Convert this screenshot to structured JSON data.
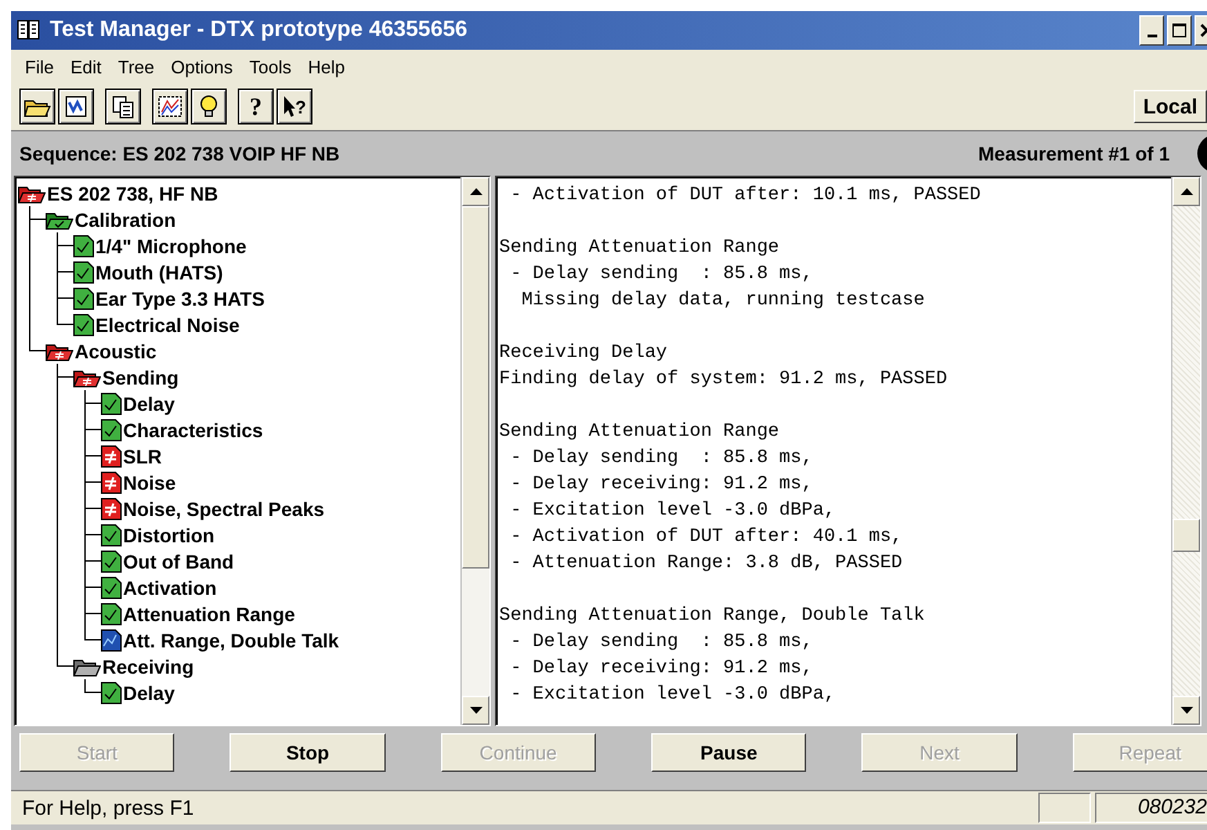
{
  "window": {
    "title": "Test Manager - DTX prototype 46355656"
  },
  "menu": [
    "File",
    "Edit",
    "Tree",
    "Options",
    "Tools",
    "Help"
  ],
  "toolbar": {
    "help_glyph": "?",
    "context_help_glyph": "?",
    "mode_button": "Local"
  },
  "sequence_bar": {
    "sequence": "Sequence: ES 202 738 VOIP HF NB",
    "measurement": "Measurement #1 of 1"
  },
  "tree": [
    {
      "label": "ES 202 738, HF NB",
      "kind": "folder",
      "passed": false,
      "failed": true,
      "children": [
        {
          "label": "Calibration",
          "kind": "folder",
          "passed": true,
          "failed": false,
          "children": [
            {
              "label": "1/4\" Microphone",
              "kind": "test",
              "passed": true,
              "failed": false
            },
            {
              "label": "Mouth (HATS)",
              "kind": "test",
              "passed": true,
              "failed": false
            },
            {
              "label": "Ear Type 3.3 HATS",
              "kind": "test",
              "passed": true,
              "failed": false
            },
            {
              "label": "Electrical Noise",
              "kind": "test",
              "passed": true,
              "failed": false
            }
          ]
        },
        {
          "label": "Acoustic",
          "kind": "folder",
          "passed": false,
          "failed": true,
          "children": [
            {
              "label": "Sending",
              "kind": "folder",
              "passed": false,
              "failed": true,
              "children": [
                {
                  "label": "Delay",
                  "kind": "test",
                  "passed": true,
                  "failed": false
                },
                {
                  "label": "Characteristics",
                  "kind": "test",
                  "passed": true,
                  "failed": false
                },
                {
                  "label": "SLR",
                  "kind": "test",
                  "passed": false,
                  "failed": true
                },
                {
                  "label": "Noise",
                  "kind": "test",
                  "passed": false,
                  "failed": true
                },
                {
                  "label": "Noise, Spectral Peaks",
                  "kind": "test",
                  "passed": false,
                  "failed": true
                },
                {
                  "label": "Distortion",
                  "kind": "test",
                  "passed": true,
                  "failed": false
                },
                {
                  "label": "Out of Band",
                  "kind": "test",
                  "passed": true,
                  "failed": false
                },
                {
                  "label": "Activation",
                  "kind": "test",
                  "passed": true,
                  "failed": false
                },
                {
                  "label": "Attenuation Range",
                  "kind": "test",
                  "passed": true,
                  "failed": false
                },
                {
                  "label": "Att. Range, Double Talk",
                  "kind": "test",
                  "passed": false,
                  "failed": false
                }
              ]
            },
            {
              "label": "Receiving",
              "kind": "folder",
              "passed": false,
              "failed": false,
              "children": [
                {
                  "label": "Delay",
                  "kind": "test",
                  "passed": true,
                  "failed": false
                }
              ]
            }
          ]
        }
      ]
    }
  ],
  "log": [
    [
      " - Activation of DUT after: 10.1 ms, PASSED"
    ],
    [
      "Sending Attenuation Range",
      " - Delay sending  : 85.8 ms,",
      "  Missing delay data, running testcase"
    ],
    [
      "Receiving Delay",
      "Finding delay of system: 91.2 ms, PASSED"
    ],
    [
      "Sending Attenuation Range",
      " - Delay sending  : 85.8 ms,",
      " - Delay receiving: 91.2 ms,",
      " - Excitation level -3.0 dBPa,",
      " - Activation of DUT after: 40.1 ms,",
      " - Attenuation Range: 3.8 dB, PASSED"
    ],
    [
      "Sending Attenuation Range, Double Talk",
      " - Delay sending  : 85.8 ms,",
      " - Delay receiving: 91.2 ms,",
      " - Excitation level -3.0 dBPa,"
    ]
  ],
  "buttons": [
    {
      "label": "Start",
      "disabled": true
    },
    {
      "label": "Stop",
      "disabled": false
    },
    {
      "label": "Continue",
      "disabled": true
    },
    {
      "label": "Pause",
      "disabled": false
    },
    {
      "label": "Next",
      "disabled": true
    },
    {
      "label": "Repeat",
      "disabled": true
    }
  ],
  "status_bar": {
    "help": "For Help, press F1",
    "code": "080232"
  }
}
